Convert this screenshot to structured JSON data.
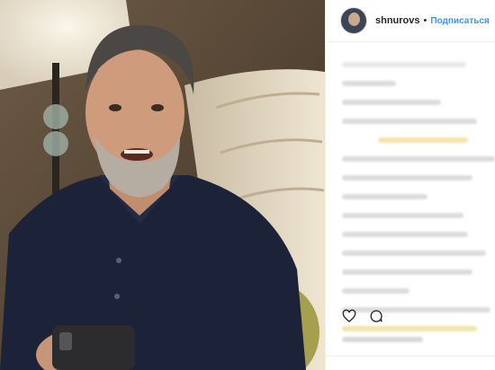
{
  "post": {
    "username": "shnurovs",
    "separator": "•",
    "follow_label": "Подписаться"
  },
  "colors": {
    "username": "#262626",
    "follow": "#3897f0",
    "border": "#efefef"
  },
  "icons": [
    "heart-icon",
    "comment-icon"
  ]
}
